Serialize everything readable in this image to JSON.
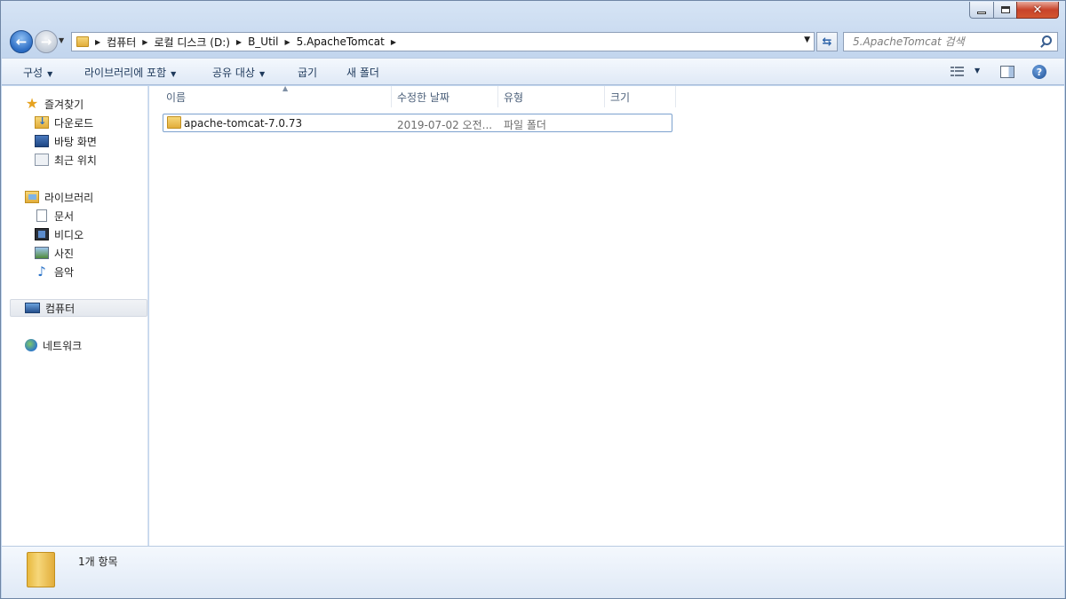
{
  "window": {
    "minimize_glyph": "—",
    "maximize_glyph": "□",
    "close_glyph": "✕"
  },
  "nav": {
    "back_glyph": "←",
    "forward_glyph": "→"
  },
  "address": {
    "crumbs": [
      "컴퓨터",
      "로컬 디스크 (D:)",
      "B_Util",
      "5.ApacheTomcat"
    ]
  },
  "search": {
    "placeholder": "5.ApacheTomcat 검색"
  },
  "toolbar": {
    "organize": "구성",
    "include_in_library": "라이브러리에 포함",
    "share_with": "공유 대상",
    "burn": "굽기",
    "new_folder": "새 폴더",
    "help_glyph": "?"
  },
  "sidebar": {
    "favorites_header": "즐겨찾기",
    "favorites": [
      "다운로드",
      "바탕 화면",
      "최근 위치"
    ],
    "libraries_header": "라이브러리",
    "libraries": [
      "문서",
      "비디오",
      "사진",
      "음악"
    ],
    "computer": "컴퓨터",
    "network": "네트워크"
  },
  "columns": {
    "name": "이름",
    "date_modified": "수정한 날짜",
    "type": "유형",
    "size": "크기"
  },
  "files": [
    {
      "name": "apache-tomcat-7.0.73",
      "date": "2019-07-02 오전...",
      "type": "파일 폴더",
      "size": ""
    }
  ],
  "details": {
    "item_count": "1개 항목"
  }
}
